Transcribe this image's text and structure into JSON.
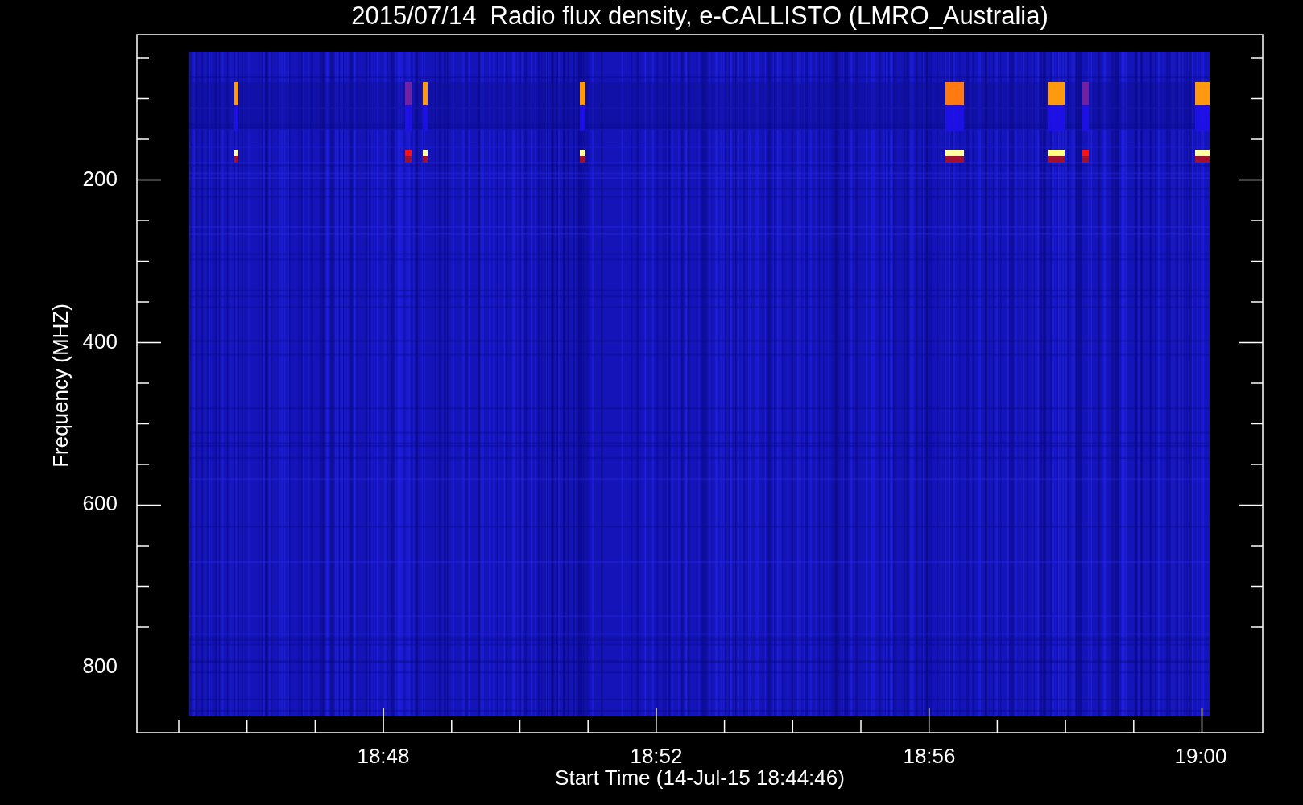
{
  "title": "2015/07/14  Radio flux density, e-CALLISTO (LMRO_Australia)",
  "ylabel": "Frequency (MHZ)",
  "xlabel": "Start Time (14-Jul-15 18:44:46)",
  "yticks": [
    "200",
    "400",
    "600",
    "800"
  ],
  "xticks": [
    "18:48",
    "18:52",
    "18:56",
    "19:00"
  ]
}
